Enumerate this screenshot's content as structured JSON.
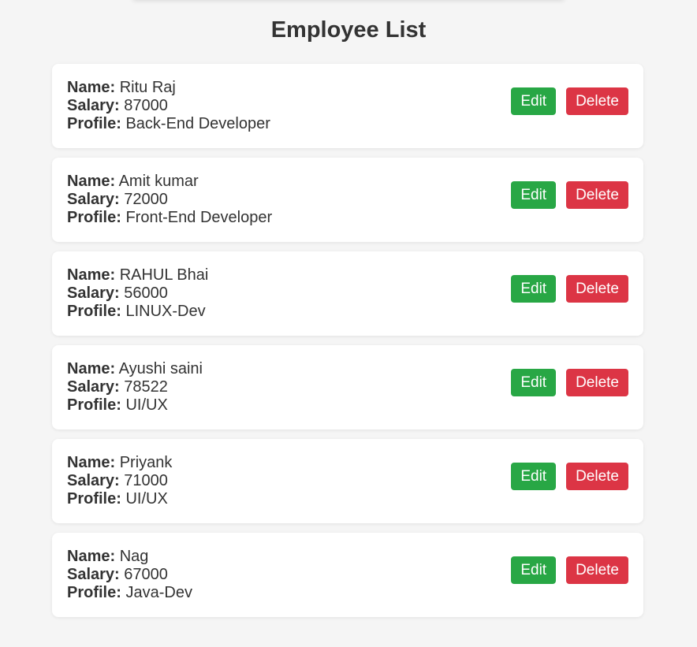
{
  "page": {
    "title": "Employee List"
  },
  "labels": {
    "name": "Name:",
    "salary": "Salary:",
    "profile": "Profile:",
    "edit": "Edit",
    "delete": "Delete"
  },
  "colors": {
    "background": "#f5f5f5",
    "card": "#ffffff",
    "edit_button": "#28a745",
    "delete_button": "#dc3545",
    "text": "#333333"
  },
  "employees": [
    {
      "name": "Ritu Raj",
      "salary": "87000",
      "profile": "Back-End Developer"
    },
    {
      "name": "Amit kumar",
      "salary": "72000",
      "profile": "Front-End Developer"
    },
    {
      "name": "RAHUL Bhai",
      "salary": "56000",
      "profile": "LINUX-Dev"
    },
    {
      "name": "Ayushi saini",
      "salary": "78522",
      "profile": "UI/UX"
    },
    {
      "name": "Priyank",
      "salary": "71000",
      "profile": "UI/UX"
    },
    {
      "name": "Nag",
      "salary": "67000",
      "profile": "Java-Dev"
    }
  ]
}
